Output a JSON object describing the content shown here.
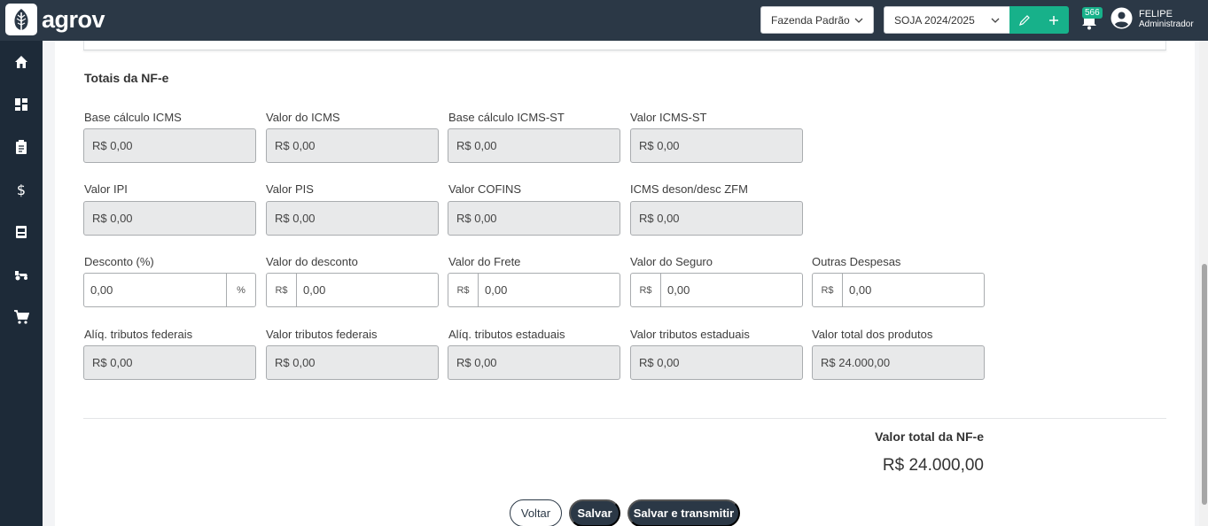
{
  "header": {
    "brand": "agrov",
    "farm_select": "Fazenda Padrão",
    "season_select": "SOJA 2024/2025",
    "notifications_count": "566",
    "user_name": "FELIPE",
    "user_role": "Administrador"
  },
  "sidebar": {
    "items": [
      {
        "icon": "home-icon"
      },
      {
        "icon": "dashboard-icon"
      },
      {
        "icon": "clipboard-icon"
      },
      {
        "icon": "dollar-icon"
      },
      {
        "icon": "warehouse-icon"
      },
      {
        "icon": "tractor-icon"
      },
      {
        "icon": "cart-icon"
      }
    ]
  },
  "section": {
    "title": "Totais da NF-e"
  },
  "fields": {
    "base_icms": {
      "label": "Base cálculo ICMS",
      "value": "R$ 0,00"
    },
    "valor_icms": {
      "label": "Valor do ICMS",
      "value": "R$ 0,00"
    },
    "base_icms_st": {
      "label": "Base cálculo ICMS-ST",
      "value": "R$ 0,00"
    },
    "valor_icms_st": {
      "label": "Valor ICMS-ST",
      "value": "R$ 0,00"
    },
    "valor_ipi": {
      "label": "Valor IPI",
      "value": "R$ 0,00"
    },
    "valor_pis": {
      "label": "Valor PIS",
      "value": "R$ 0,00"
    },
    "valor_cofins": {
      "label": "Valor COFINS",
      "value": "R$ 0,00"
    },
    "icms_deson": {
      "label": "ICMS deson/desc ZFM",
      "value": "R$ 0,00"
    },
    "desconto_pct": {
      "label": "Desconto (%)",
      "value": "0,00",
      "suffix": "%"
    },
    "valor_desconto": {
      "label": "Valor do desconto",
      "prefix": "R$",
      "value": "0,00"
    },
    "valor_frete": {
      "label": "Valor do Frete",
      "prefix": "R$",
      "value": "0,00"
    },
    "valor_seguro": {
      "label": "Valor do Seguro",
      "prefix": "R$",
      "value": "0,00"
    },
    "outras_despesas": {
      "label": "Outras Despesas",
      "prefix": "R$",
      "value": "0,00"
    },
    "aliq_fed": {
      "label": "Alíq. tributos federais",
      "value": "R$ 0,00"
    },
    "valor_fed": {
      "label": "Valor tributos federais",
      "value": "R$ 0,00"
    },
    "aliq_est": {
      "label": "Alíq. tributos estaduais",
      "value": "R$ 0,00"
    },
    "valor_est": {
      "label": "Valor tributos estaduais",
      "value": "R$ 0,00"
    },
    "total_produtos": {
      "label": "Valor total dos produtos",
      "value": "R$ 24.000,00"
    }
  },
  "total": {
    "label": "Valor total da NF-e",
    "value": "R$ 24.000,00"
  },
  "actions": {
    "back": "Voltar",
    "save": "Salvar",
    "save_transmit": "Salvar e transmitir"
  },
  "colors": {
    "topbar": "#2b3846",
    "sidebar": "#1d2a38",
    "accent": "#17b18a"
  }
}
